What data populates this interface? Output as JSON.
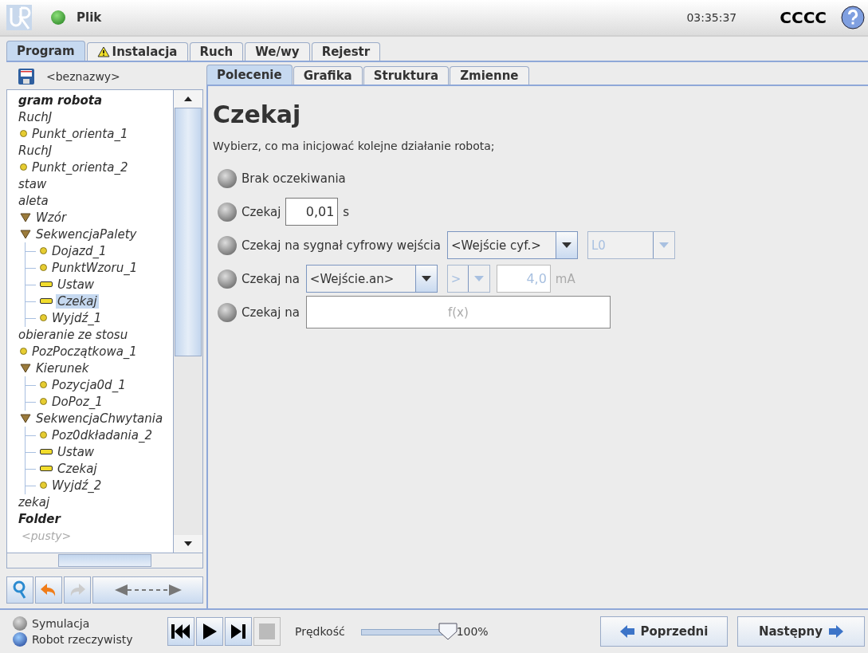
{
  "header": {
    "menu": "Plik",
    "time": "03:35:37",
    "robot_name": "CCCC"
  },
  "main_tabs": [
    {
      "label": "Program",
      "selected": true,
      "warning": false
    },
    {
      "label": "Instalacja",
      "selected": false,
      "warning": true
    },
    {
      "label": "Ruch",
      "selected": false,
      "warning": false
    },
    {
      "label": "We/wy",
      "selected": false,
      "warning": false
    },
    {
      "label": "Rejestr",
      "selected": false,
      "warning": false
    }
  ],
  "program_file": "<beznazwy>",
  "tree": [
    {
      "label": "gram robota",
      "kind": "program",
      "selected": false,
      "children": [
        {
          "label": "RuchJ",
          "kind": "plain",
          "selected": false,
          "children": [
            {
              "label": "Punkt_orienta_1",
              "kind": "waypoint",
              "selected": false
            }
          ]
        },
        {
          "label": "RuchJ",
          "kind": "plain",
          "selected": false,
          "children": [
            {
              "label": "Punkt_orienta_2",
              "kind": "waypoint",
              "selected": false
            }
          ]
        },
        {
          "label": "staw",
          "kind": "plain",
          "selected": false
        },
        {
          "label": "aleta",
          "kind": "plain",
          "selected": false,
          "children": [
            {
              "label": "Wzór",
              "kind": "group",
              "selected": false
            },
            {
              "label": "SekwencjaPalety",
              "kind": "group",
              "selected": false,
              "children": [
                {
                  "label": "Dojazd_1",
                  "kind": "waypoint",
                  "selected": false
                },
                {
                  "label": "PunktWzoru_1",
                  "kind": "waypoint",
                  "selected": false
                },
                {
                  "label": "Ustaw",
                  "kind": "command",
                  "selected": false
                },
                {
                  "label": "Czekaj",
                  "kind": "command",
                  "selected": true
                },
                {
                  "label": "Wyjdź_1",
                  "kind": "waypoint",
                  "selected": false
                }
              ]
            }
          ]
        },
        {
          "label": "obieranie ze stosu",
          "kind": "plain",
          "selected": false,
          "children": [
            {
              "label": "PozPoczątkowa_1",
              "kind": "waypoint",
              "selected": false
            },
            {
              "label": "Kierunek",
              "kind": "group",
              "selected": false,
              "children": [
                {
                  "label": "Pozycja0d_1",
                  "kind": "waypoint",
                  "selected": false
                },
                {
                  "label": "DoPoz_1",
                  "kind": "waypoint",
                  "selected": false
                }
              ]
            },
            {
              "label": "SekwencjaChwytania",
              "kind": "group",
              "selected": false,
              "children": [
                {
                  "label": "Poz0dkładania_2",
                  "kind": "waypoint",
                  "selected": false
                },
                {
                  "label": "Ustaw",
                  "kind": "command",
                  "selected": false
                },
                {
                  "label": "Czekaj",
                  "kind": "command",
                  "selected": false
                },
                {
                  "label": "Wyjdź_2",
                  "kind": "waypoint",
                  "selected": false
                }
              ]
            }
          ]
        },
        {
          "label": "zekaj",
          "kind": "plain",
          "selected": false
        },
        {
          "label": "Folder",
          "kind": "folder",
          "selected": false,
          "children": [
            {
              "label": "<pusty>",
              "kind": "placeholder",
              "selected": false
            }
          ]
        }
      ]
    }
  ],
  "sub_tabs": [
    {
      "label": "Polecenie",
      "selected": true
    },
    {
      "label": "Grafika",
      "selected": false
    },
    {
      "label": "Struktura",
      "selected": false
    },
    {
      "label": "Zmienne",
      "selected": false
    }
  ],
  "command": {
    "title": "Czekaj",
    "instruction": "Wybierz, co ma inicjować kolejne działanie robota;",
    "options": [
      {
        "kind": "none",
        "label": "Brak oczekiwania",
        "selected": false
      },
      {
        "kind": "time",
        "label": "Czekaj",
        "value": "0,01",
        "unit": "s",
        "selected": false
      },
      {
        "kind": "digital",
        "label": "Czekaj na sygnał cyfrowy wejścia",
        "input": "<Wejście cyf.>",
        "state": "L0",
        "selected": false
      },
      {
        "kind": "analog",
        "label": "Czekaj na",
        "input": "<Wejście.an>",
        "operator": ">",
        "value": "4,0",
        "unit": "mA",
        "selected": false
      },
      {
        "kind": "expression",
        "label": "Czekaj na",
        "placeholder": "f(x)",
        "selected": false
      }
    ]
  },
  "footer": {
    "modes": [
      {
        "label": "Symulacja",
        "selected": false
      },
      {
        "label": "Robot rzeczywisty",
        "selected": true
      }
    ],
    "speed_label": "Prędkość",
    "speed": {
      "level": 1.0
    },
    "speed_reading": "100%",
    "prev": "Poprzedni",
    "next": "Następny"
  }
}
